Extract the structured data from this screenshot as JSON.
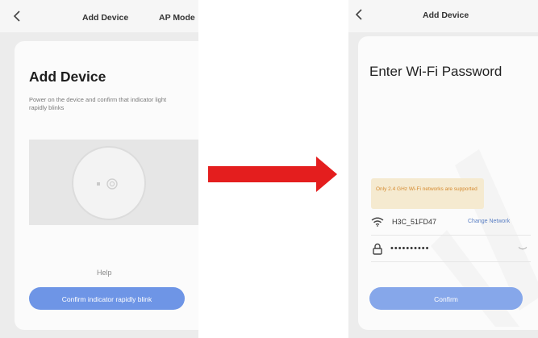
{
  "colors": {
    "primary_button": "#6e95e6",
    "primary_button_light": "#86a7ea",
    "arrow": "#e41e1e",
    "notice_background": "#f5ead0",
    "notice_text": "#d58a2f",
    "link": "#5a7fc4"
  },
  "left_screen": {
    "nav": {
      "back_icon": "chevron-left-icon",
      "title": "Add Device",
      "action": "AP Mode"
    },
    "heading": "Add Device",
    "description": "Power on the device and confirm that indicator light rapidly blinks",
    "illustration_icon": "device-power-button-icon",
    "help": "Help",
    "confirm_button": "Confirm indicator rapidly blink"
  },
  "arrow_icon": "right-arrow-icon",
  "right_screen": {
    "nav": {
      "back_icon": "chevron-left-icon",
      "title": "Add Device"
    },
    "heading": "Enter Wi-Fi Password",
    "notice": "Only 2.4 GHz Wi-Fi networks are supported",
    "network": {
      "icon": "wifi-icon",
      "ssid": "H3C_51FD47",
      "change_label": "Change Network"
    },
    "password": {
      "icon": "lock-icon",
      "value": "••••••••••",
      "toggle_icon": "eye-closed-icon"
    },
    "confirm_button": "Confirm"
  }
}
